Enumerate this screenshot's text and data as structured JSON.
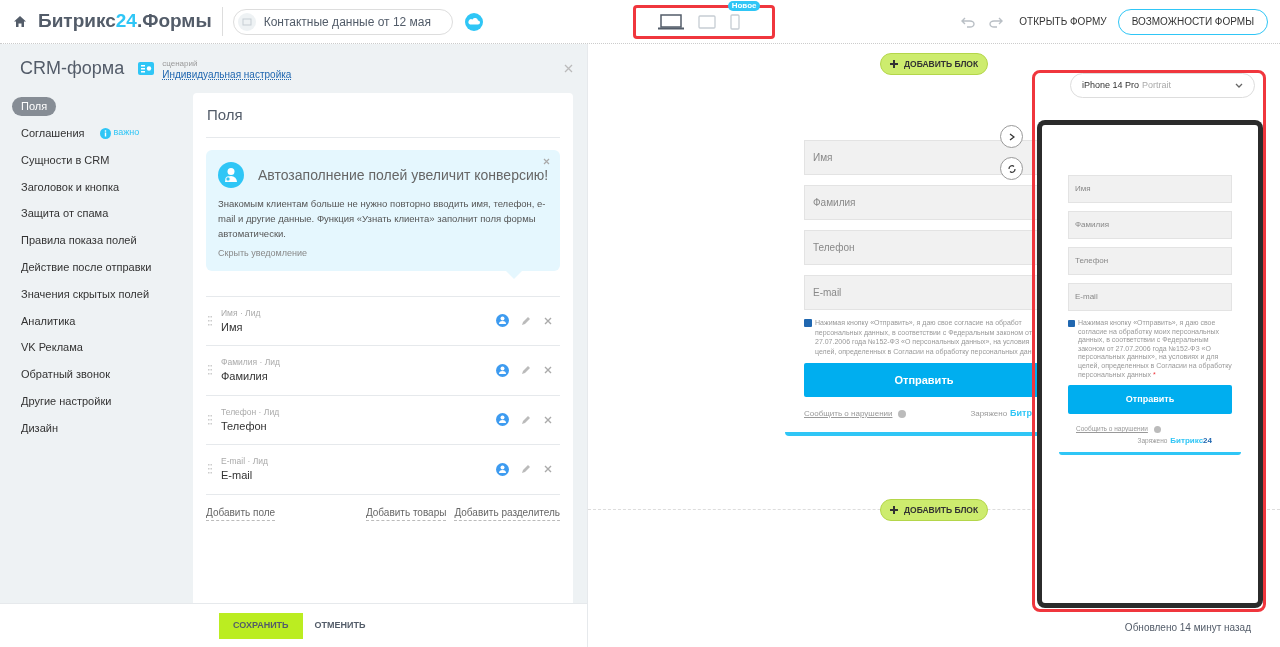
{
  "header": {
    "logo_parts": [
      "Битрикс",
      "24",
      ".Формы"
    ],
    "form_name": "Контактные данные от 12 мая",
    "devices": [
      {
        "kind": "laptop",
        "selected": true
      },
      {
        "kind": "tablet",
        "selected": false
      },
      {
        "kind": "phone",
        "selected": false,
        "badge": "Новое"
      }
    ],
    "open_form": "ОТКРЫТЬ ФОРМУ",
    "features": "ВОЗМОЖНОСТИ ФОРМЫ"
  },
  "panel": {
    "title": "CRM-форма",
    "scenario_label": "сценарий",
    "scenario": "Индивидуальная настройка"
  },
  "sidebar": {
    "items": [
      {
        "label": "Поля",
        "selected": true
      },
      {
        "label": "Соглашения",
        "selected": false,
        "badge": "важно"
      },
      {
        "label": "Сущности в CRM",
        "selected": false
      },
      {
        "label": "Заголовок и кнопка",
        "selected": false
      },
      {
        "label": "Защита от спама",
        "selected": false
      },
      {
        "label": "Правила показа полей",
        "selected": false
      },
      {
        "label": "Действие после отправки",
        "selected": false
      },
      {
        "label": "Значения скрытых полей",
        "selected": false
      },
      {
        "label": "Аналитика",
        "selected": false
      },
      {
        "label": "VK Реклама",
        "selected": false
      },
      {
        "label": "Обратный звонок",
        "selected": false
      },
      {
        "label": "Другие настройки",
        "selected": false
      },
      {
        "label": "Дизайн",
        "selected": false
      }
    ]
  },
  "fields_card": {
    "title": "Поля",
    "notice": {
      "title": "Автозаполнение полей увеличит конверсию!",
      "text": "Знакомым клиентам больше не нужно повторно вводить имя, телефон, e-mail и другие данные. Функция «Узнать клиента» заполнит поля формы автоматически.",
      "hide": "Скрыть уведомление"
    },
    "fields": [
      {
        "caption": "Имя · Лид",
        "name": "Имя"
      },
      {
        "caption": "Фамилия · Лид",
        "name": "Фамилия"
      },
      {
        "caption": "Телефон · Лид",
        "name": "Телефон"
      },
      {
        "caption": "E-mail · Лид",
        "name": "E-mail"
      }
    ],
    "add_field": "Добавить поле",
    "add_products": "Добавить товары",
    "add_divider": "Добавить разделитель"
  },
  "footer": {
    "save": "СОХРАНИТЬ",
    "cancel": "ОТМЕНИТЬ"
  },
  "preview": {
    "add_block": [
      "ДОБАВИТЬ БЛОК",
      "ДОБАВИТЬ БЛОК"
    ],
    "desktop": {
      "placeholders": [
        "Имя",
        "Фамилия",
        "Телефон",
        "E-mail"
      ],
      "checked": true,
      "consent_lines": [
        "Нажимая кнопку «Отправить», я даю свое согласие на обработ",
        "персональных данных, в соответствии с Федеральным законом от",
        "27.07.2006 года №152-ФЗ «О персональных данных», на условия",
        "целей, определенных в Согласии на обработку персональных дан"
      ],
      "submit": "Отправить",
      "report": "Сообщить о нарушении",
      "charged": "Заряжено",
      "brand": "Битр"
    },
    "device_select": {
      "model": "iPhone 14 Pro",
      "orientation": "Portrait"
    },
    "phone": {
      "placeholders": [
        "Имя",
        "Фамилия",
        "Телефон",
        "E-mail"
      ],
      "checked": true,
      "consent": "Нажимая кнопку «Отправить», я даю свое согласие на обработку моих персональных данных, в соответствии с Федеральным законом от 27.07.2006 года №152-ФЗ «О персональных данных», на условиях и для целей, определенных в Согласии на обработку персональных данных",
      "required_mark": "*",
      "submit": "Отправить",
      "report": "Сообщить о нарушении",
      "charged": "Заряжено",
      "brand_parts": [
        "Битрикс",
        "24"
      ]
    },
    "updated": "Обновлено 14 минут назад"
  }
}
